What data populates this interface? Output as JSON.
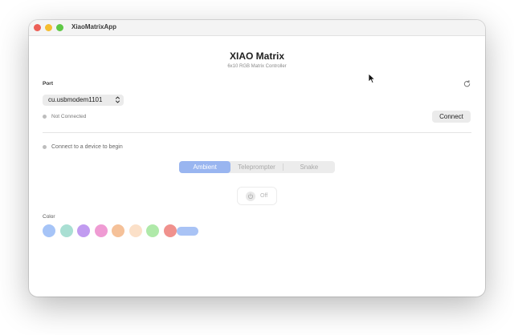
{
  "window": {
    "title": "XiaoMatrixApp"
  },
  "header": {
    "title": "XIAO Matrix",
    "subtitle": "6x10 RGB Matrix Controller"
  },
  "port": {
    "label": "Port",
    "selected": "cu.usbmodem1101",
    "refresh_icon": "refresh-icon"
  },
  "connection": {
    "status": "Not Connected",
    "connect_label": "Connect",
    "status_color": "#bdbdbd"
  },
  "hint": {
    "text": "Connect to a device to begin"
  },
  "modes": {
    "tabs": [
      {
        "label": "Ambient",
        "active": true
      },
      {
        "label": "Teleprompter",
        "active": false
      },
      {
        "label": "Snake",
        "active": false
      }
    ]
  },
  "power": {
    "label": "Off",
    "icon": "power-icon"
  },
  "colors": {
    "label": "Color",
    "swatches": [
      "#a6c4f7",
      "#a9dfd3",
      "#c19bf0",
      "#ef9bd3",
      "#f5c199",
      "#fbe0c8",
      "#afe9a9",
      "#f0918d"
    ],
    "selected_pill": "#a9c3f5"
  }
}
